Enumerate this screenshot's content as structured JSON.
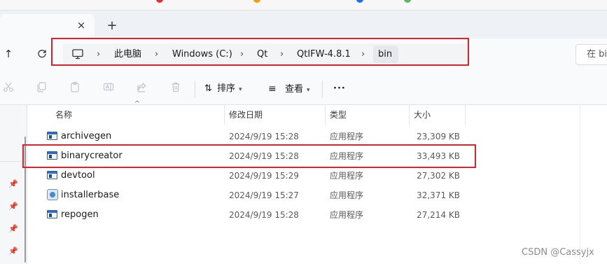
{
  "window": {
    "tab_close": "×",
    "tab_add": "+"
  },
  "nav": {
    "up_icon": "arrow-up-icon",
    "refresh_icon": "refresh-icon"
  },
  "breadcrumb": {
    "root_icon": "computer-icon",
    "items": [
      "此电脑",
      "Windows (C:)",
      "Qt",
      "QtIFW-4.8.1",
      "bin"
    ],
    "separator": "›"
  },
  "search": {
    "placeholder": "在 bi"
  },
  "toolbar": {
    "sort_label": "排序",
    "view_label": "查看",
    "more_label": "···",
    "icons": [
      "cut-icon",
      "copy-icon",
      "paste-icon",
      "rename-icon",
      "share-icon",
      "delete-icon"
    ]
  },
  "table": {
    "columns": [
      "名称",
      "修改日期",
      "类型",
      "大小"
    ],
    "rows": [
      {
        "name": "archivegen",
        "date": "2024/9/19 15:28",
        "type": "应用程序",
        "size": "23,309 KB"
      },
      {
        "name": "binarycreator",
        "date": "2024/9/19 15:28",
        "type": "应用程序",
        "size": "33,493 KB"
      },
      {
        "name": "devtool",
        "date": "2024/9/19 15:29",
        "type": "应用程序",
        "size": "27,302 KB"
      },
      {
        "name": "installerbase",
        "date": "2024/9/19 15:27",
        "type": "应用程序",
        "size": "32,371 KB"
      },
      {
        "name": "repogen",
        "date": "2024/9/19 15:28",
        "type": "应用程序",
        "size": "27,214 KB"
      }
    ]
  },
  "watermark": "CSDN @Cassyjx",
  "colors": {
    "highlight_border": "#d9232d",
    "window_bg": "#f9fafc"
  }
}
